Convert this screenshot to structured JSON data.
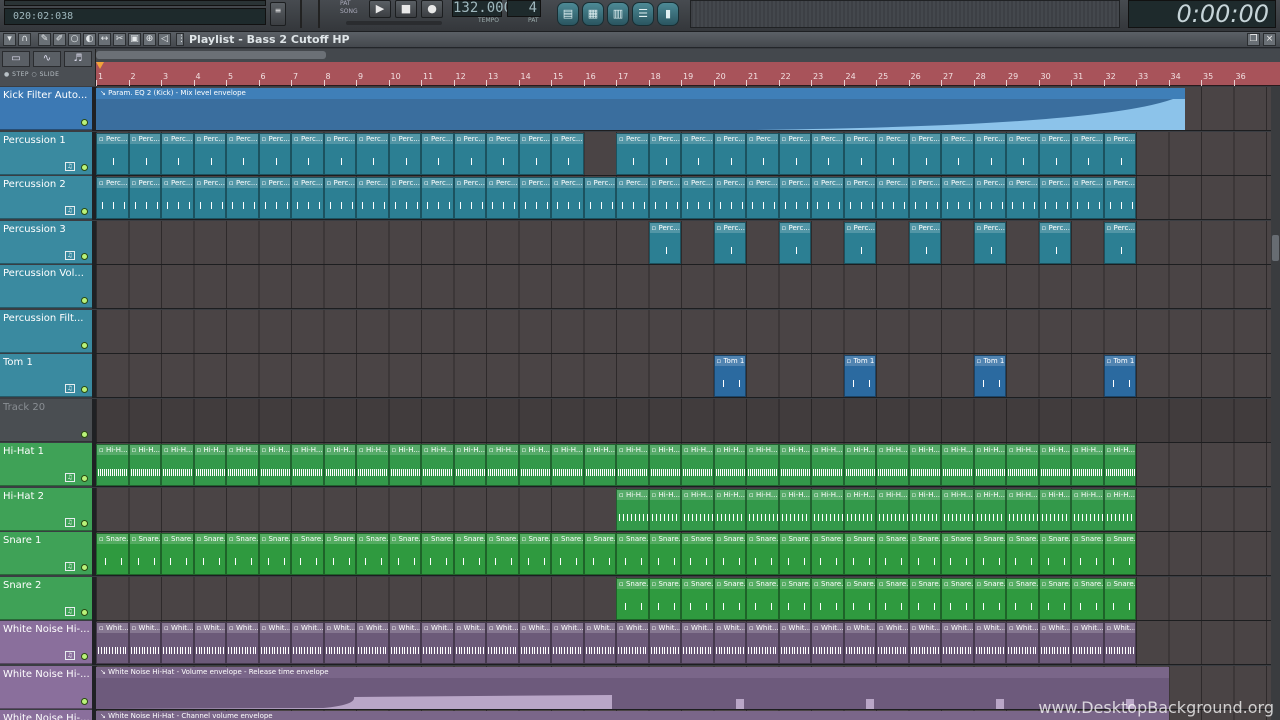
{
  "transport": {
    "hint": "020:02:038",
    "time": "0:00:00",
    "tempo": "132.000",
    "tempo_label": "TEMPO",
    "pattern": "4",
    "pattern_label": "PAT",
    "pat_label": "PAT",
    "song_label": "SONG",
    "play": "▶",
    "stop": "■",
    "record": "●"
  },
  "playlist": {
    "title": "Playlist - Bass 2 Cutoff HP",
    "step_slide": "● STEP  ○ SLIDE",
    "bars": [
      "1",
      "2",
      "3",
      "4",
      "5",
      "6",
      "7",
      "8",
      "9",
      "10",
      "11",
      "12",
      "13",
      "14",
      "15",
      "16",
      "17",
      "18",
      "19",
      "20",
      "21",
      "22",
      "23",
      "24",
      "25",
      "26",
      "27",
      "28",
      "29",
      "30",
      "31",
      "32",
      "33",
      "34",
      "35",
      "36"
    ]
  },
  "tracks": [
    {
      "name": "Kick Filter Auto...",
      "color": "#3c79b4",
      "kind": "envelope",
      "label": "Param. EQ 2 (Kick) - Mix level envelope",
      "start": 1,
      "end": 34
    },
    {
      "name": "Percussion 1",
      "color": "#3a8aa0",
      "kind": "pattern",
      "clip_label": "Perc...",
      "clip_color": "#2c7f93",
      "ranges": [
        [
          1,
          16
        ],
        [
          17,
          33
        ]
      ],
      "notes": 1
    },
    {
      "name": "Percussion 2",
      "color": "#3a8aa0",
      "kind": "pattern",
      "clip_label": "Perc...",
      "clip_color": "#2c7f93",
      "ranges": [
        [
          1,
          33
        ]
      ],
      "notes": 3
    },
    {
      "name": "Percussion 3",
      "color": "#3a8aa0",
      "kind": "sparse",
      "clip_label": "Perc...",
      "clip_color": "#2c7f93",
      "bars": [
        18,
        20,
        22,
        24,
        26,
        28,
        30,
        32
      ],
      "notes": 1
    },
    {
      "name": "Percussion Vol...",
      "color": "#3a8aa0",
      "kind": "empty"
    },
    {
      "name": "Percussion Filt...",
      "color": "#3a8aa0",
      "kind": "empty"
    },
    {
      "name": "Tom 1",
      "color": "#3a8aa0",
      "kind": "sparse",
      "clip_label": "Tom 1",
      "clip_color": "#2b6aa0",
      "bars": [
        20,
        24,
        28,
        32
      ],
      "notes": 2
    },
    {
      "name": "Track 20",
      "color": "#4a4e52",
      "kind": "empty",
      "dim": true
    },
    {
      "name": "Hi-Hat 1",
      "color": "#3fa257",
      "kind": "pattern",
      "clip_label": "Hi-H...",
      "clip_color": "#33994a",
      "ranges": [
        [
          1,
          33
        ]
      ],
      "notes": 16
    },
    {
      "name": "Hi-Hat 2",
      "color": "#3fa257",
      "kind": "pattern",
      "clip_label": "Hi-H...",
      "clip_color": "#33994a",
      "ranges": [
        [
          17,
          33
        ]
      ],
      "notes": 8
    },
    {
      "name": "Snare 1",
      "color": "#3fa257",
      "kind": "pattern",
      "clip_label": "Snare...",
      "clip_color": "#2f9a3f",
      "ranges": [
        [
          1,
          33
        ]
      ],
      "notes": 2
    },
    {
      "name": "Snare 2",
      "color": "#3fa257",
      "kind": "pattern",
      "clip_label": "Snare...",
      "clip_color": "#2f9a3f",
      "ranges": [
        [
          17,
          33
        ]
      ],
      "notes": 2
    },
    {
      "name": "White Noise Hi-...",
      "color": "#8a6f9c",
      "kind": "pattern",
      "clip_label": "Whit...",
      "clip_color": "#6c5a79",
      "ranges": [
        [
          1,
          33
        ]
      ],
      "notes": 12
    },
    {
      "name": "White Noise Hi-...",
      "color": "#8a6f9c",
      "kind": "envelope",
      "label": "White Noise Hi-Hat - Volume envelope - Release time envelope",
      "start": 1,
      "end": 33
    },
    {
      "name": "White Noise Hi-...",
      "color": "#8a6f9c",
      "kind": "envelope",
      "label": "White Noise Hi-Hat - Channel volume envelope",
      "start": 1,
      "end": 33
    }
  ],
  "watermark": "www.DesktopBackground.org"
}
